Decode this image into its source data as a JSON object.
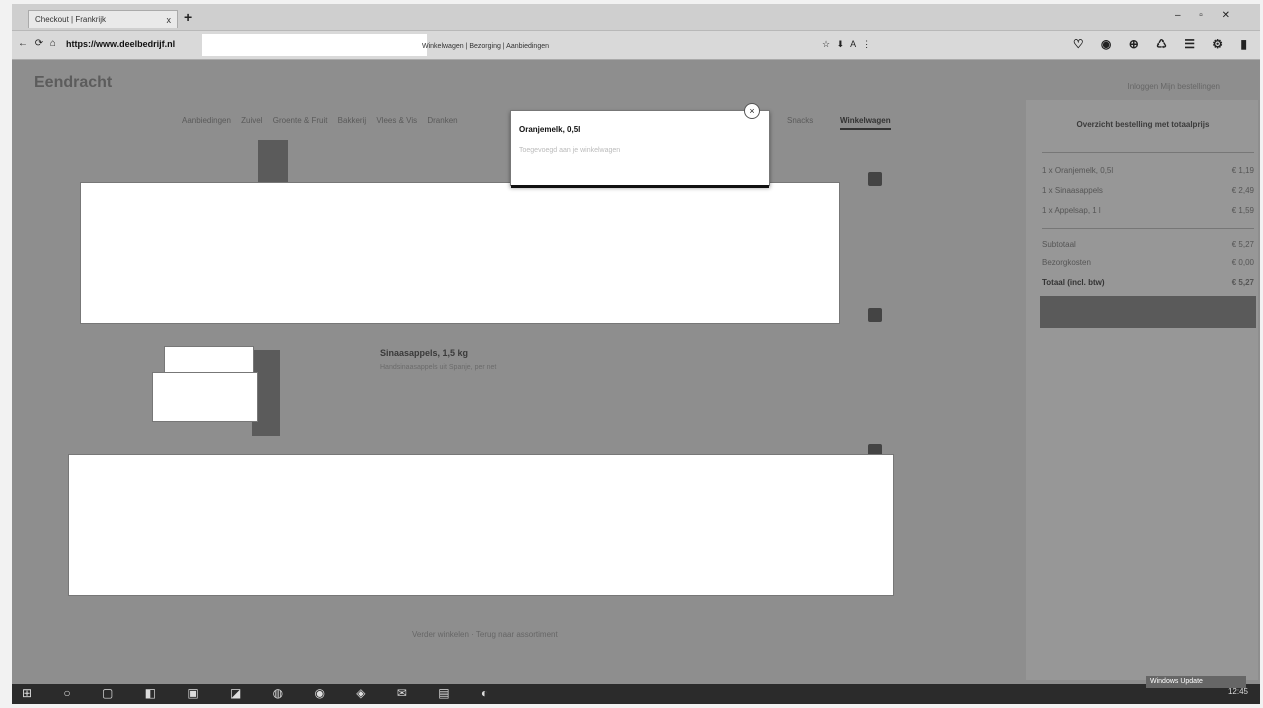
{
  "browser": {
    "tab_title": "Checkout | Frankrijk",
    "tab_close": "x",
    "new_tab": "+",
    "window_controls": "– ▫ ✕",
    "nav_icons": "← ⟳ ⌂",
    "url": "https://www.deelbedrijf.nl",
    "page_title": "Winkelwagen | Bezorging | Aanbiedingen",
    "address_right": "☆ ⬇ A  ⋮",
    "extension_icons": "♡ ◉ ⊕ ♺ ☰ ⚙ ▮"
  },
  "site": {
    "logo": "Eendracht",
    "top_links": "Inloggen    Mijn bestellingen",
    "menu": [
      "Aanbiedingen",
      "Zuivel",
      "Groente & Fruit",
      "Bakkerij",
      "Vlees & Vis",
      "Dranken"
    ],
    "menu_right": "Snacks",
    "menu_active": "Winkelwagen"
  },
  "popup": {
    "title": "Oranjemelk, 0,5l",
    "subtitle": "Toegevoegd aan je winkelwagen",
    "close": "×"
  },
  "items": {
    "item2_title": "Sinaasappels, 1,5 kg",
    "item2_desc": "Handsinaasappels uit Spanje, per net"
  },
  "footer": {
    "link": "Verder winkelen  ·  Terug naar assortiment"
  },
  "summary": {
    "heading": "Overzicht bestelling met totaalprijs",
    "rows": [
      {
        "label": "1 x Oranjemelk, 0,5l",
        "amount": "€ 1,19"
      },
      {
        "label": "1 x Sinaasappels",
        "amount": "€ 2,49"
      },
      {
        "label": "1 x Appelsap, 1 l",
        "amount": "€ 1,59"
      }
    ],
    "totals": [
      {
        "label": "Subtotaal",
        "amount": "€ 5,27"
      },
      {
        "label": "Bezorgkosten",
        "amount": "€ 0,00"
      },
      {
        "label": "Totaal (incl. btw)",
        "amount": "€ 5,27"
      }
    ]
  },
  "taskbar": {
    "icons": "⊞ ○ ▢ ◧ ▣ ◪ ◍ ◉ ◈ ✉ ▤ ◐",
    "tray": "12:45",
    "notification": "Windows Update"
  }
}
